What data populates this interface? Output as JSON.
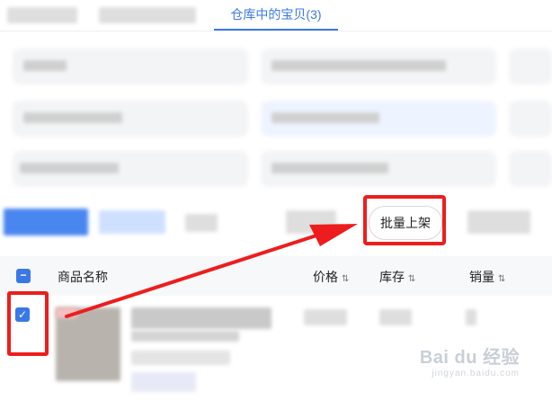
{
  "tabs": {
    "active_label": "仓库中的宝贝(3)"
  },
  "toolbar": {
    "batch_shelf_label": "批量上架"
  },
  "table": {
    "headers": {
      "name": "商品名称",
      "price": "价格",
      "stock": "库存",
      "sales": "销量"
    },
    "sort_icon": "⇅"
  },
  "watermark": {
    "text": "Bai du 经验",
    "sub": "jingyan.baidu.com"
  },
  "colors": {
    "accent": "#3a78e8",
    "annotation": "#ee1d1d"
  }
}
